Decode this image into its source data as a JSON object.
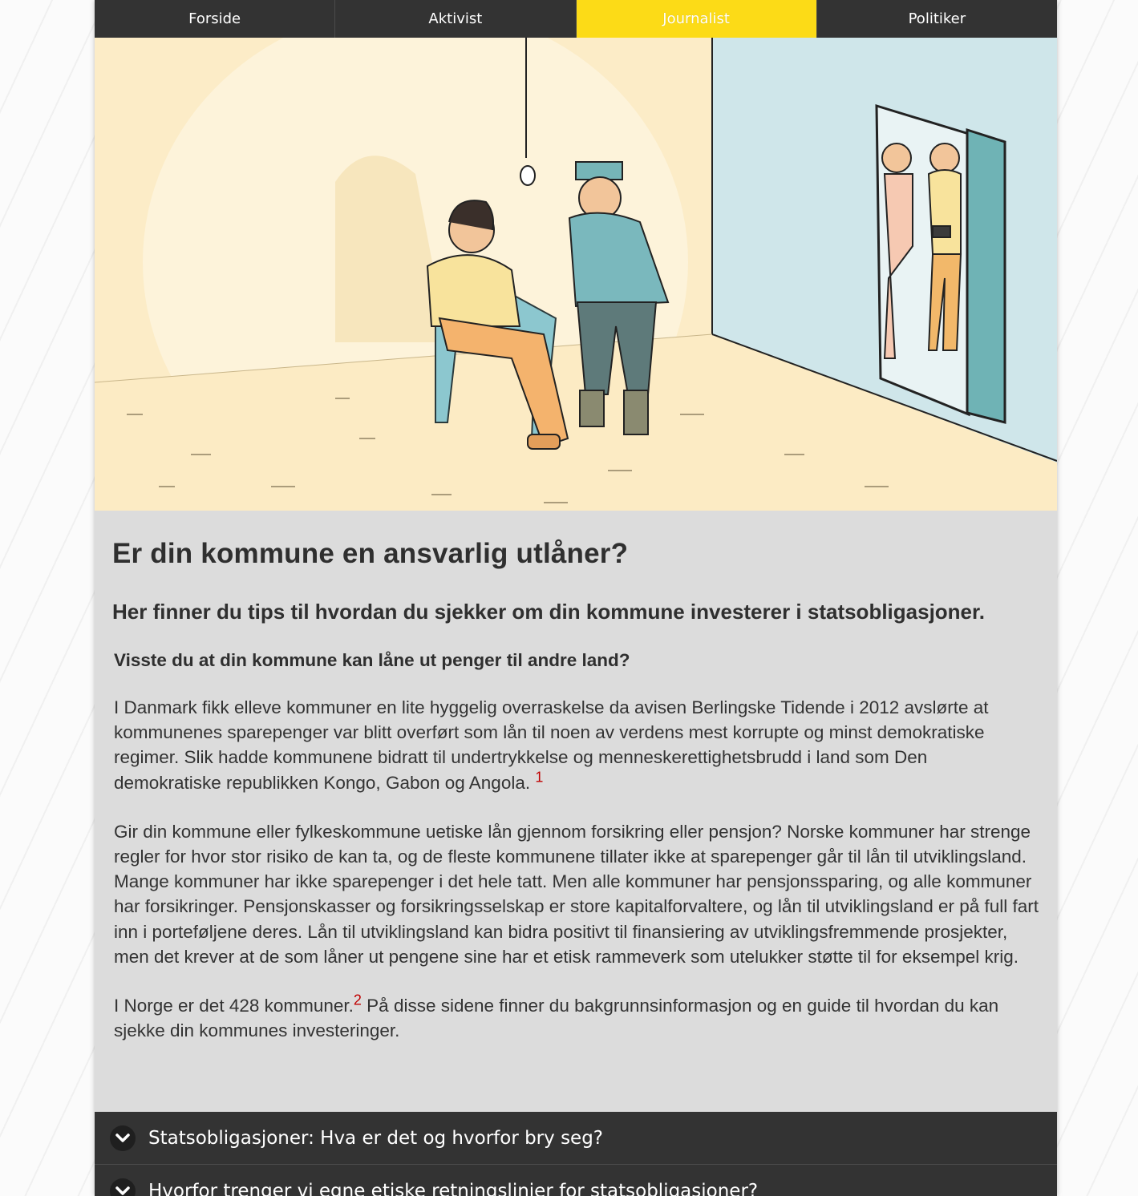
{
  "nav": {
    "tabs": [
      {
        "label": "Forside",
        "active": false
      },
      {
        "label": "Aktivist",
        "active": false
      },
      {
        "label": "Journalist",
        "active": true
      },
      {
        "label": "Politiker",
        "active": false
      }
    ]
  },
  "hero": {
    "illustration": "comic illustration of a seated prisoner, a uniformed guard and two journalists at an open cell door"
  },
  "main": {
    "title": "Er din kommune en ansvarlig utlåner?",
    "lead": "Her finner du tips til hvordan du sjekker om din kommune investerer i statsobligasjoner.",
    "subhead": "Visste du at din kommune kan låne ut penger til andre land?",
    "paragraph1": "I Danmark fikk elleve kommuner en lite hyggelig overraskelse da avisen Berlingske Tidende i 2012 avslørte at kommunenes sparepenger var blitt overført som lån til noen av verdens mest korrupte og minst demokratiske regimer. Slik hadde kommunene bidratt til undertrykkelse og menneskerettighetsbrudd i land som Den demokratiske republikken Kongo, Gabon og Angola.",
    "footnote1": "1",
    "paragraph2": "Gir din kommune eller fylkeskommune uetiske lån gjennom forsikring eller pensjon? Norske kommuner har strenge regler for hvor stor risiko de kan ta, og de fleste kommunene tillater ikke at sparepenger går til lån til utviklingsland. Mange kommuner har ikke sparepenger i det hele tatt. Men alle kommuner har pensjonssparing, og alle kommuner har forsikringer. Pensjonskasser og forsikringsselskap er store kapitalforvaltere, og lån til utviklingsland er på full fart inn i porteføljene deres. Lån til utviklingsland kan bidra positivt til finansiering av utviklingsfremmende prosjekter, men det krever at de som låner ut pengene sine har et etisk rammeverk som utelukker støtte til for eksempel krig.",
    "paragraph3_a": "I Norge er det 428 kommuner.",
    "footnote2": "2",
    "paragraph3_b": " På disse sidene finner du bakgrunnsinformasjon og en guide til hvordan du kan sjekke din kommunes investeringer."
  },
  "accordion": {
    "items": [
      {
        "label": "Statsobligasjoner: Hva er det og hvorfor bry seg?",
        "icon": "chevron-down-icon"
      },
      {
        "label": "Hvorfor trenger vi egne etiske retningslinjer for statsobligasjoner?",
        "icon": "chevron-down-icon"
      }
    ]
  },
  "colors": {
    "nav_bg": "#333333",
    "nav_active": "#fcdb17",
    "content_bg": "#dcdcdc",
    "footnote": "#c00000",
    "hero_wall_left": "#fcecc7",
    "hero_wall_right": "#cfe6ea"
  }
}
